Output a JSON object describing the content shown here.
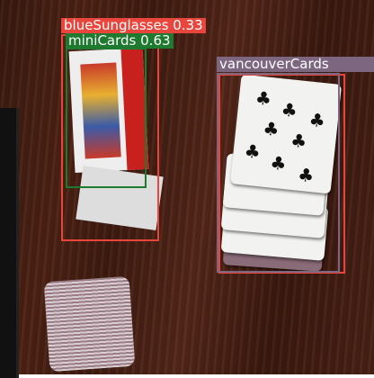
{
  "detections": [
    {
      "label": "blueSunglasses",
      "score": "0.33",
      "color": "#e8453c"
    },
    {
      "label": "miniCards",
      "score": "0.63",
      "color": "#1e7a2e"
    },
    {
      "label": "vancouverCards",
      "score": "",
      "color": "#7d6680"
    },
    {
      "label": "",
      "score": "",
      "color": "#e8453c"
    }
  ]
}
